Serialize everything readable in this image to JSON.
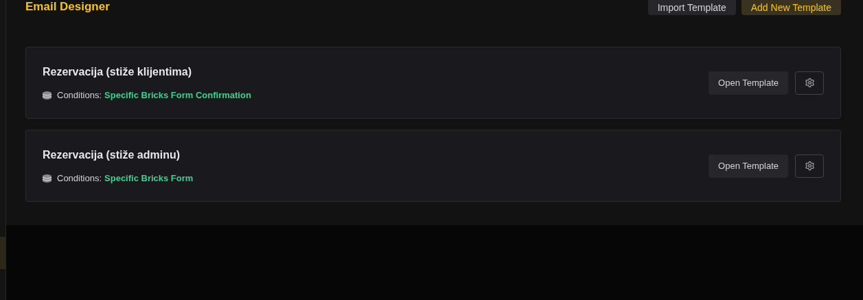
{
  "header": {
    "title": "Email Designer",
    "buttons": [
      {
        "label": "Import Template",
        "kind": "secondary"
      },
      {
        "label": "Add New Template",
        "kind": "primary"
      }
    ]
  },
  "templates": [
    {
      "name": "Rezervacija (stiže klijentima)",
      "conditions_label": "Conditions:",
      "condition": "Specific Bricks Form Confirmation",
      "open_label": "Open Template"
    },
    {
      "name": "Rezervacija (stiže adminu)",
      "conditions_label": "Conditions:",
      "condition": "Specific Bricks Form",
      "open_label": "Open Template"
    }
  ]
}
